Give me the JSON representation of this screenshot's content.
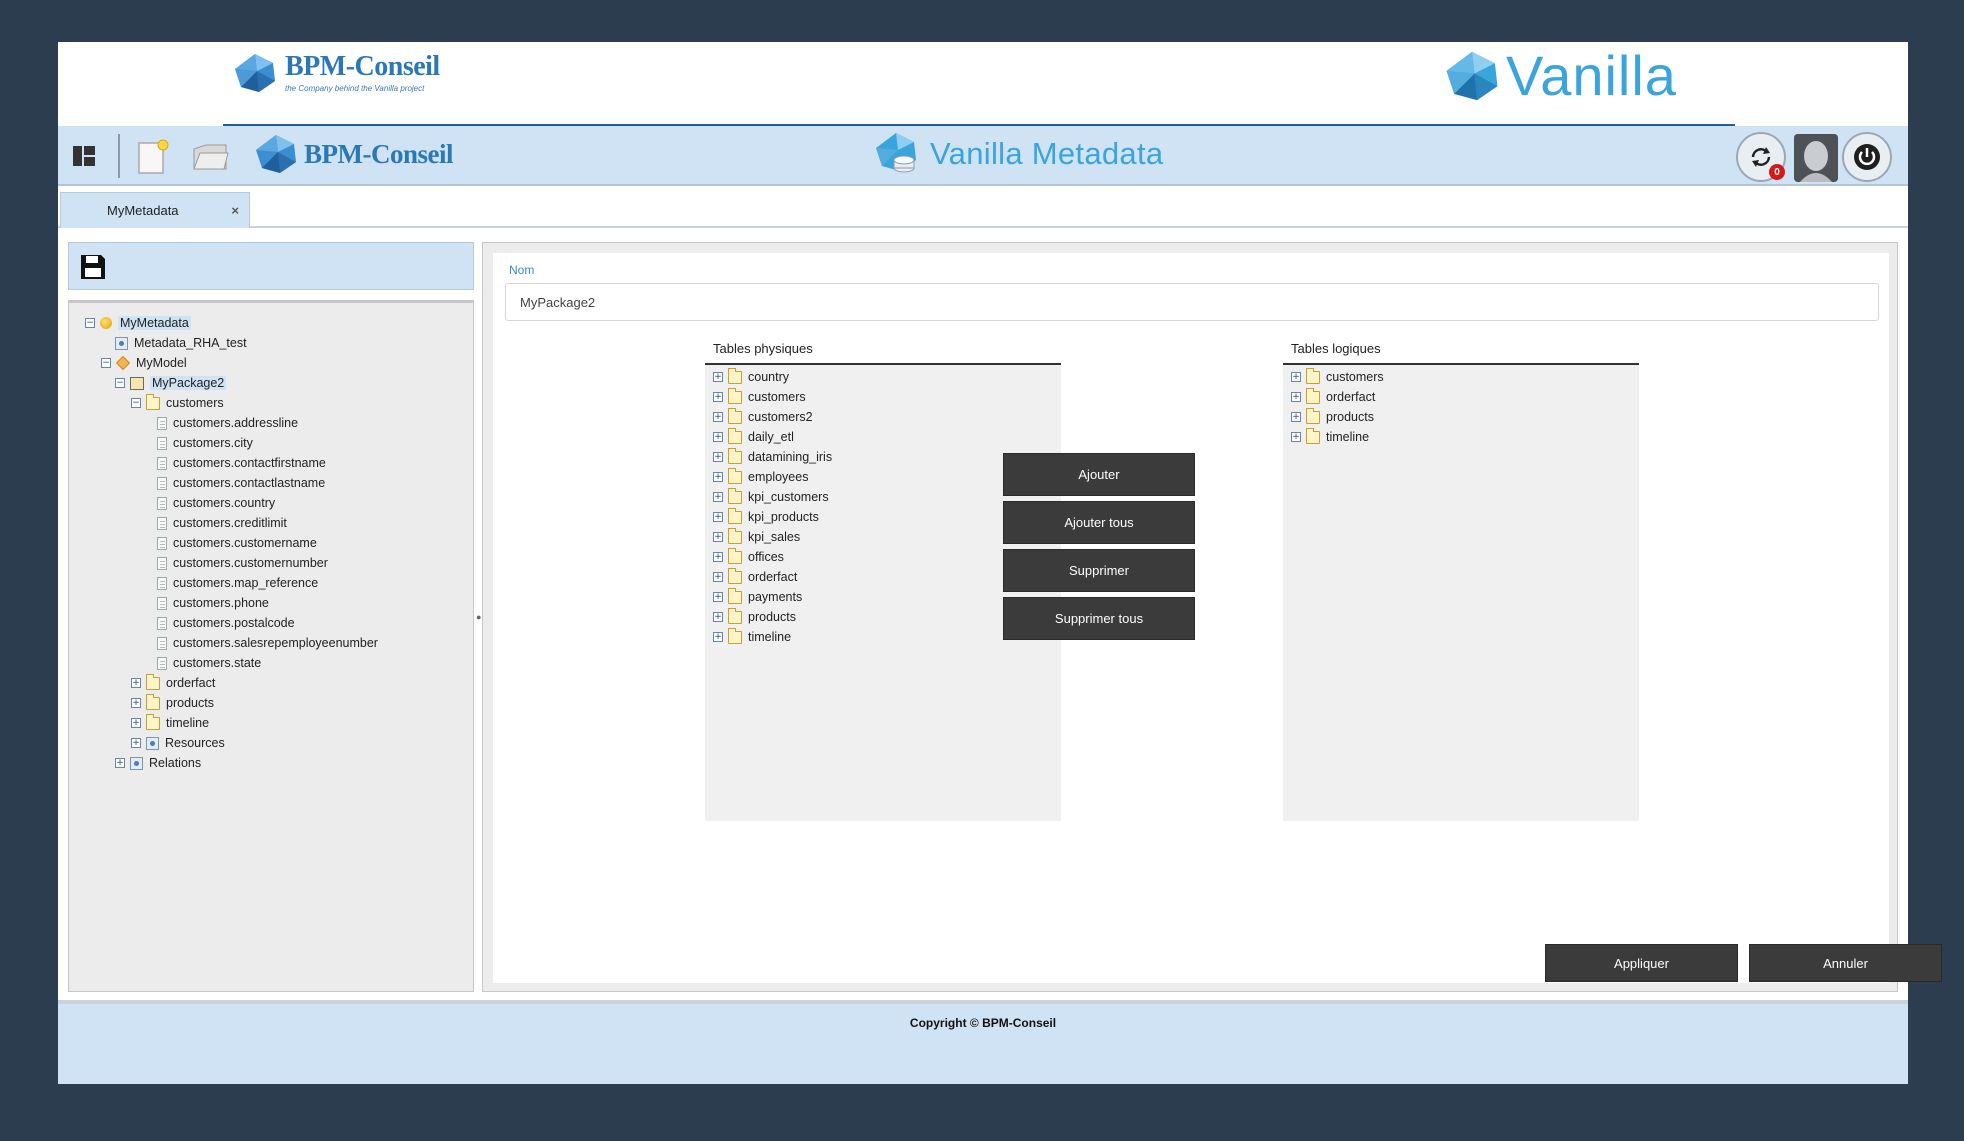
{
  "brand": {
    "left_name": "BPM-Conseil",
    "left_tagline": "the Company behind the Vanilla project",
    "right_name": "Vanilla"
  },
  "toolbar": {
    "brand_name": "BPM-Conseil",
    "app_title": "Vanilla Metadata",
    "notification_count": "0",
    "icons": [
      "layout-icon",
      "new-document-icon",
      "open-folder-icon",
      "refresh-icon",
      "avatar",
      "power-icon"
    ]
  },
  "tabs": [
    {
      "label": "MyMetadata",
      "close": "×"
    }
  ],
  "tree": {
    "root": "MyMetadata",
    "datasource": "Metadata_RHA_test",
    "model": "MyModel",
    "package": "MyPackage2",
    "table": "customers",
    "columns": [
      "customers.addressline",
      "customers.city",
      "customers.contactfirstname",
      "customers.contactlastname",
      "customers.country",
      "customers.creditlimit",
      "customers.customername",
      "customers.customernumber",
      "customers.map_reference",
      "customers.phone",
      "customers.postalcode",
      "customers.salesrepemployeenumber",
      "customers.state"
    ],
    "other_tables": [
      "orderfact",
      "products",
      "timeline"
    ],
    "resources": "Resources",
    "relations": "Relations"
  },
  "form": {
    "nom_label": "Nom",
    "nom_value": "MyPackage2",
    "physical_label": "Tables physiques",
    "physical_tables": [
      "country",
      "customers",
      "customers2",
      "daily_etl",
      "datamining_iris",
      "employees",
      "kpi_customers",
      "kpi_products",
      "kpi_sales",
      "offices",
      "orderfact",
      "payments",
      "products",
      "timeline"
    ],
    "logical_label": "Tables logiques",
    "logical_tables": [
      "customers",
      "orderfact",
      "products",
      "timeline"
    ],
    "buttons": {
      "add": "Ajouter",
      "add_all": "Ajouter tous",
      "remove": "Supprimer",
      "remove_all": "Supprimer tous",
      "apply": "Appliquer",
      "cancel": "Annuler"
    }
  },
  "footer": {
    "copyright": "Copyright © BPM-Conseil"
  },
  "colors": {
    "page_bg": "#2d3d50",
    "toolbar_bg": "#cfe3f4",
    "brand_blue": "#2a78b8",
    "vanilla_blue": "#3aa4dc",
    "dark_button": "#3b3b3b",
    "badge_red": "#d21a1a"
  }
}
